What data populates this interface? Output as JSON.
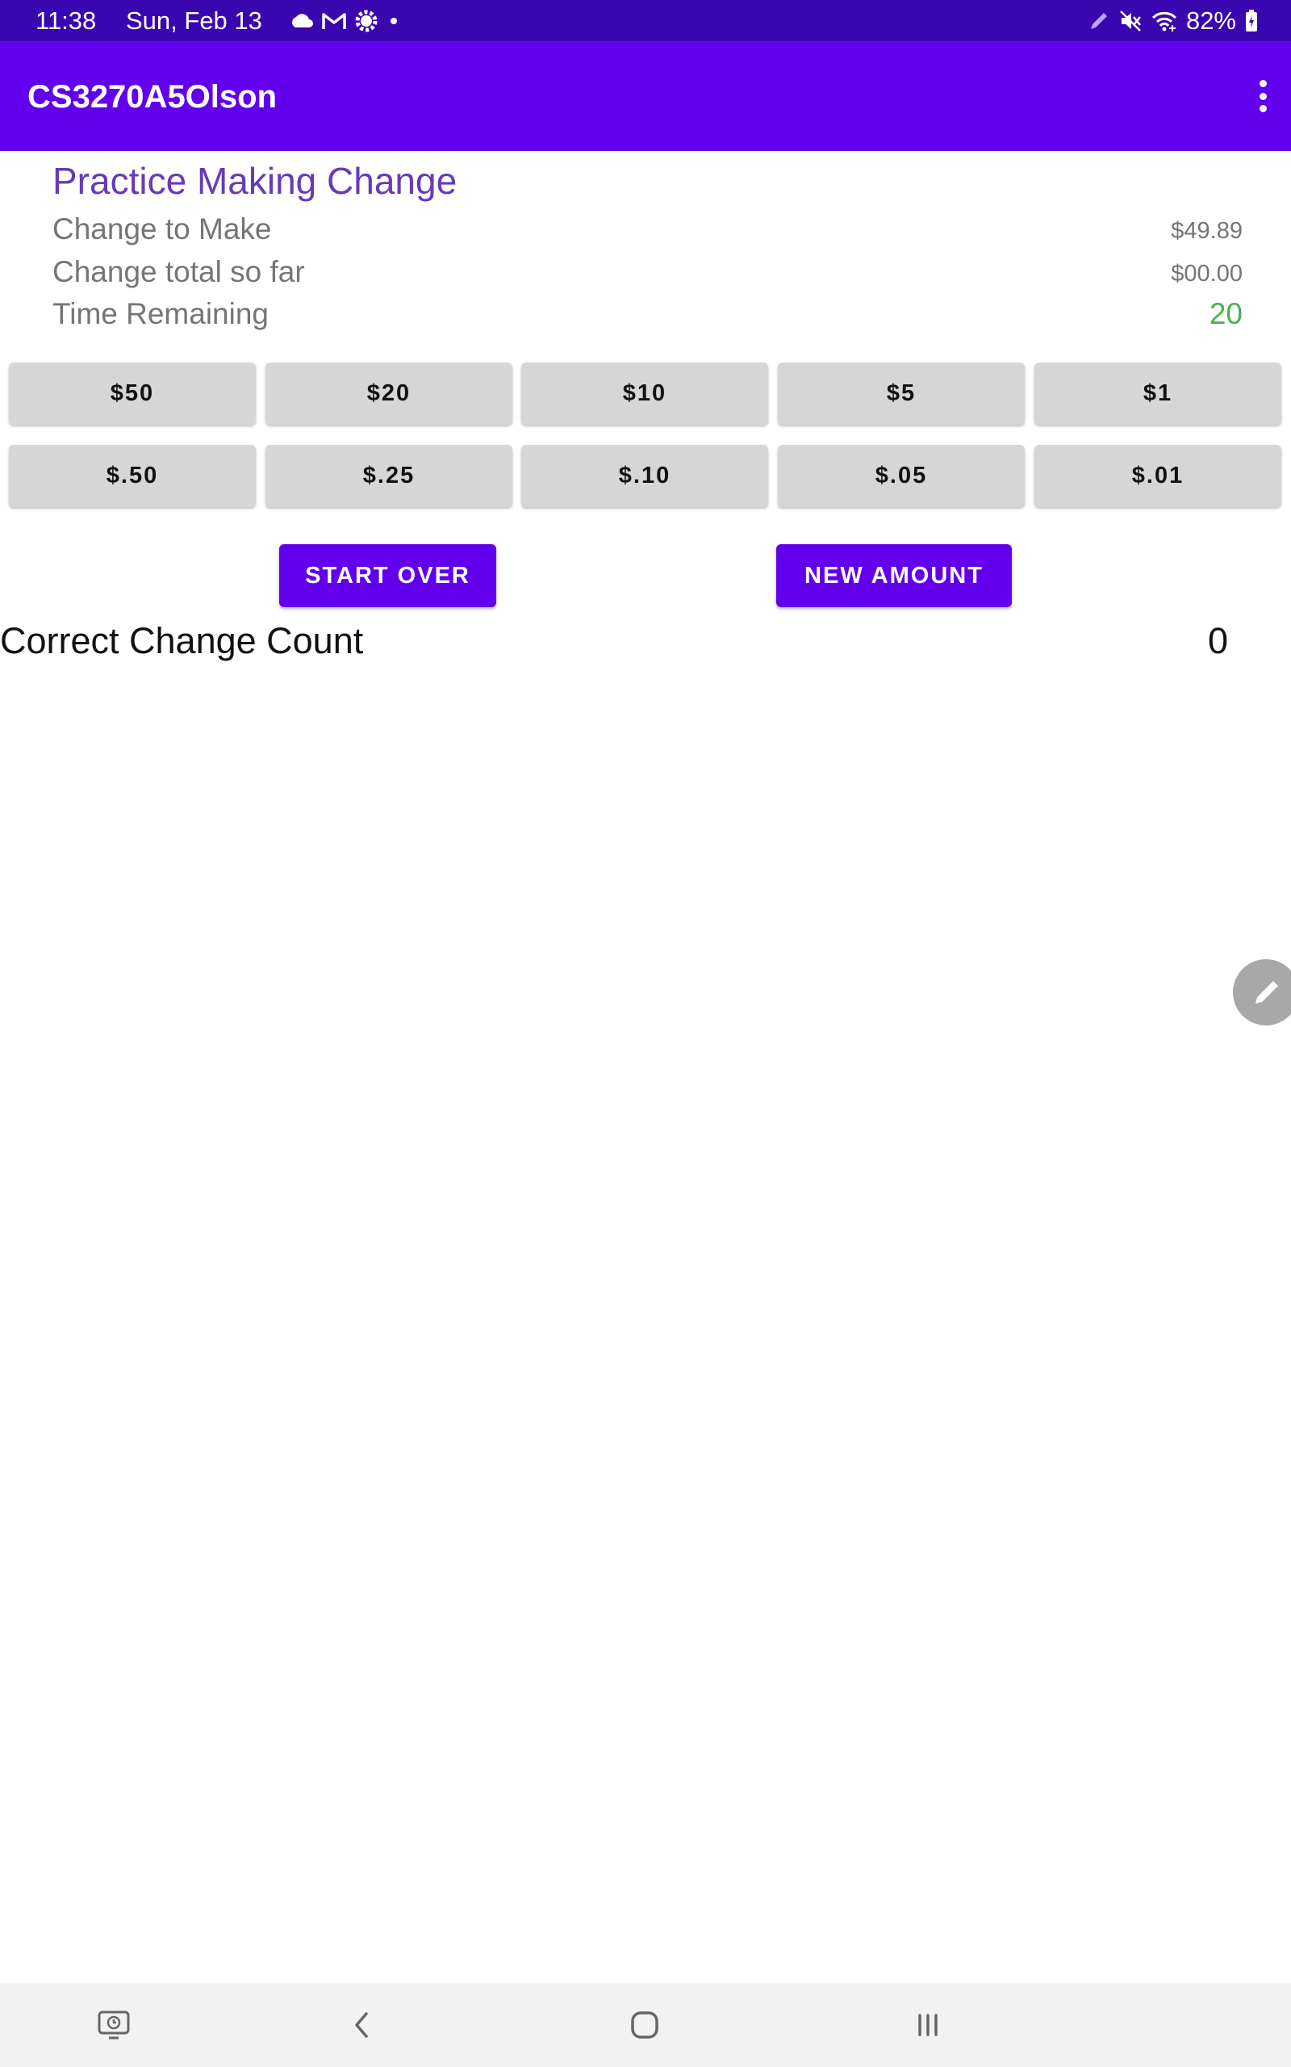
{
  "status_bar": {
    "time": "11:38",
    "date": "Sun, Feb 13",
    "battery": "82%",
    "notification_icons": [
      "cloud-icon",
      "gmail-icon",
      "settings-gear-icon",
      "dot-icon"
    ],
    "system_icons": [
      "pen-icon",
      "mute-icon",
      "wifi-icon",
      "battery-icon"
    ]
  },
  "app_bar": {
    "title": "CS3270A5Olson",
    "menu_icon": "overflow-menu-icon"
  },
  "main": {
    "heading": "Practice Making Change",
    "rows": [
      {
        "label": "Change to Make",
        "value": "$49.89"
      },
      {
        "label": "Change total so far",
        "value": "$00.00"
      },
      {
        "label": "Time Remaining",
        "value": "20"
      }
    ],
    "denominations_row1": [
      "$50",
      "$20",
      "$10",
      "$5",
      "$1"
    ],
    "denominations_row2": [
      "$.50",
      "$.25",
      "$.10",
      "$.05",
      "$.01"
    ],
    "start_over_label": "START OVER",
    "new_amount_label": "NEW AMOUNT",
    "correct_count_label": "Correct Change Count",
    "correct_count_value": "0"
  },
  "nav_bar": {
    "icons": [
      "screen-recorder-icon",
      "back-icon",
      "home-icon",
      "recents-icon"
    ]
  },
  "colors": {
    "status_bar": "#3a06b0",
    "primary": "#6200ee",
    "heading": "#673ab7",
    "time_remaining": "#4caf50",
    "button_gray": "#d6d6d6"
  }
}
